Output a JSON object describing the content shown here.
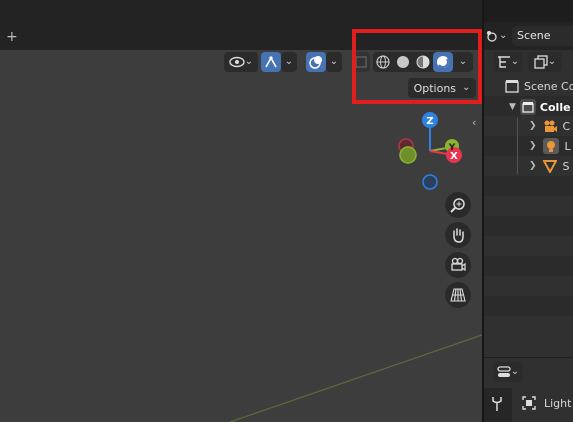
{
  "topbar": {
    "add_tab_label": "+"
  },
  "viewport_header": {
    "options_label": "Options",
    "active_color": "#4772b3",
    "highlight_color": "#e01e1e"
  },
  "gizmo": {
    "z_label": "Z",
    "y_label": "Y",
    "x_label": "X",
    "x_color": "#e8344f",
    "y_color": "#8bb531",
    "z_color": "#2f83e0"
  },
  "outliner": {
    "scene_name": "Scene",
    "items": [
      {
        "label": "Scene Co",
        "icon": "scene-collection-icon"
      },
      {
        "label": "Colle",
        "icon": "collection-icon"
      },
      {
        "label": "C",
        "icon": "camera-icon"
      },
      {
        "label": "L",
        "icon": "light-icon"
      },
      {
        "label": "S",
        "icon": "mesh-icon"
      }
    ]
  },
  "properties": {
    "object_label": "Light"
  }
}
